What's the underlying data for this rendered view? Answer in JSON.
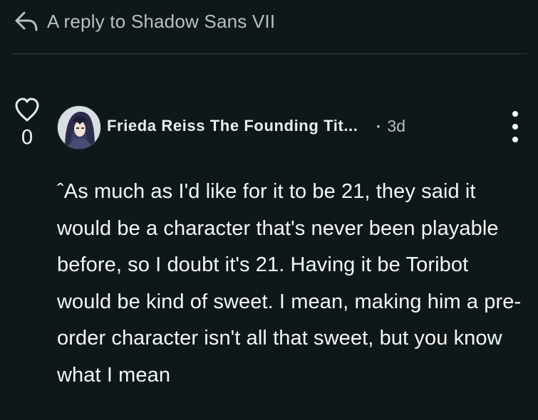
{
  "reply": {
    "icon": "reply-arrow-icon",
    "label": "A reply to Shadow Sans VII"
  },
  "post": {
    "like_icon": "heart-outline-icon",
    "like_count": "0",
    "avatar": "user-avatar",
    "author": "Frieda Reiss The Founding Tit...",
    "separator": "•",
    "age": "3d",
    "menu_icon": "more-vertical-icon",
    "body": "ˆAs much as I'd like for it to be 21, they said it would be a character that's never been playable before, so I doubt it's 21. Having it be Toribot would be kind of sweet. I mean, making him a pre-order character isn't all that sweet, but you know what I mean"
  },
  "colors": {
    "background": "#0f1819",
    "muted_text": "#b9c0c2",
    "primary_text": "#f5f7f7",
    "divider": "#2f3a3c"
  }
}
